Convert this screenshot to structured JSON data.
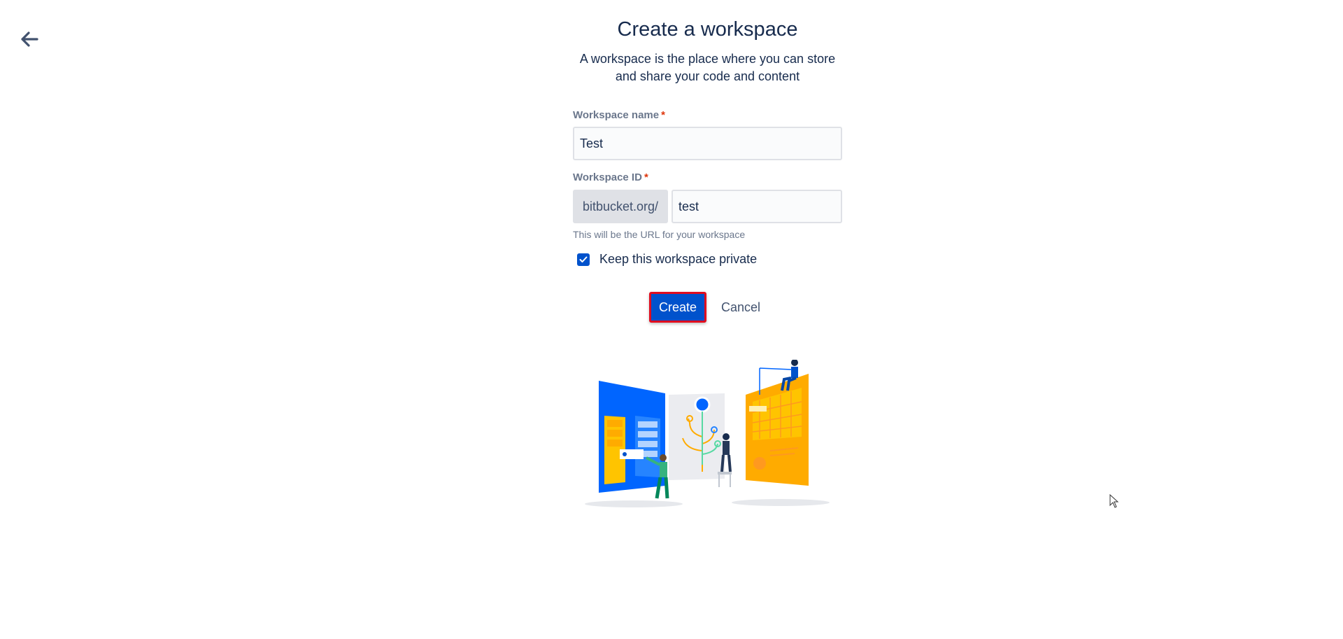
{
  "nav": {
    "back_icon": "arrow-left-icon"
  },
  "header": {
    "title": "Create a workspace",
    "subtitle_line1": "A workspace is the place where you can store",
    "subtitle_line2": "and share your code and content"
  },
  "form": {
    "workspace_name": {
      "label": "Workspace name",
      "required_mark": "*",
      "value": "Test"
    },
    "workspace_id": {
      "label": "Workspace ID",
      "required_mark": "*",
      "prefix": "bitbucket.org/",
      "value": "test",
      "helper": "This will be the URL for your workspace"
    },
    "private_checkbox": {
      "label": "Keep this workspace private",
      "checked": true
    }
  },
  "actions": {
    "create_label": "Create",
    "cancel_label": "Cancel"
  },
  "colors": {
    "primary": "#0052cc",
    "highlight_border": "#e00d1f",
    "required": "#de350b",
    "text": "#172b4d",
    "muted": "#6b778c"
  }
}
